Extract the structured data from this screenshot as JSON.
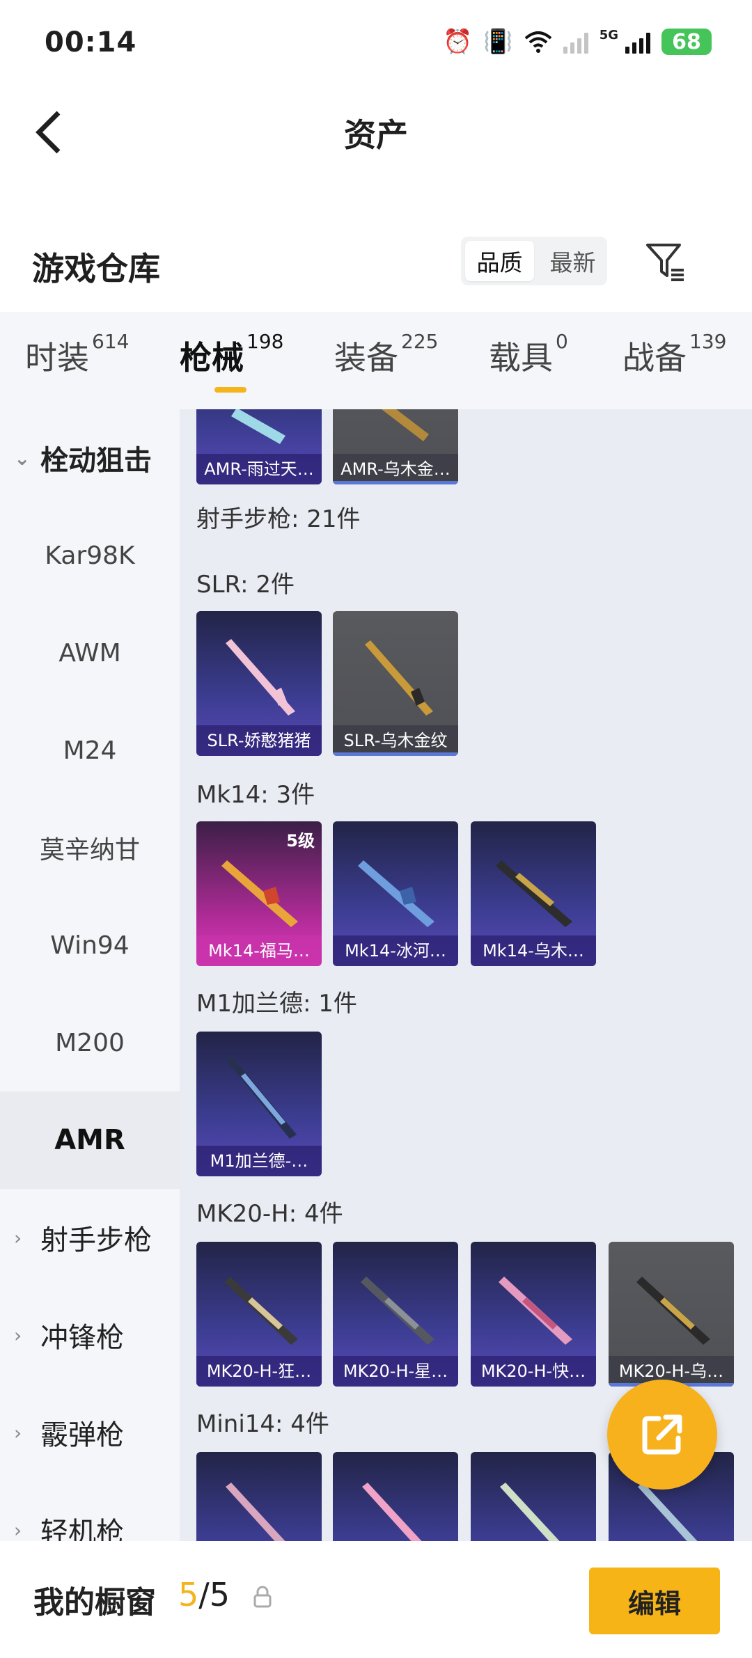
{
  "status_bar": {
    "time": "00:14",
    "network": "5G",
    "battery": "68"
  },
  "header": {
    "title": "资产",
    "back_icon": "back-arrow-icon"
  },
  "warehouse": {
    "title": "游戏仓库",
    "sort_options": [
      "品质",
      "最新"
    ],
    "active_sort": "品质",
    "filter_icon": "filter-icon"
  },
  "tabs": [
    {
      "label": "时装",
      "count": "614"
    },
    {
      "label": "枪械",
      "count": "198"
    },
    {
      "label": "装备",
      "count": "225"
    },
    {
      "label": "载具",
      "count": "0"
    },
    {
      "label": "战备",
      "count": "139"
    }
  ],
  "active_tab": "枪械",
  "sidebar": {
    "groups": [
      {
        "label": "栓动狙击",
        "expanded": true,
        "items": [
          "Kar98K",
          "AWM",
          "M24",
          "莫辛纳甘",
          "Win94",
          "M200",
          "AMR"
        ]
      },
      {
        "label": "射手步枪",
        "expanded": false
      },
      {
        "label": "冲锋枪",
        "expanded": false
      },
      {
        "label": "霰弹枪",
        "expanded": false
      },
      {
        "label": "轻机枪",
        "expanded": false
      }
    ],
    "selected": "AMR"
  },
  "content": {
    "top_partial": [
      "AMR-雨过天…",
      "AMR-乌木金…"
    ],
    "category_header": "射手步枪: 21件",
    "sections": [
      {
        "title": "SLR: 2件",
        "items": [
          "SLR-娇憨猪猪",
          "SLR-乌木金纹"
        ]
      },
      {
        "title": "Mk14: 3件",
        "items": [
          "Mk14-福马…",
          "Mk14-冰河…",
          "Mk14-乌木…"
        ],
        "level_badge": "5级"
      },
      {
        "title": "M1加兰德: 1件",
        "items": [
          "M1加兰德-…"
        ]
      },
      {
        "title": "MK20-H: 4件",
        "items": [
          "MK20-H-狂…",
          "MK20-H-星…",
          "MK20-H-快…",
          "MK20-H-乌…"
        ]
      },
      {
        "title": "Mini14: 4件",
        "items": [
          "",
          "",
          "",
          ""
        ]
      }
    ]
  },
  "fab_icon": "share-external-icon",
  "bottom_bar": {
    "title": "我的橱窗",
    "used": "5",
    "separator": "/",
    "total": "5",
    "lock_icon": "lock-icon",
    "edit_label": "编辑"
  },
  "colors": {
    "accent": "#f5b41c",
    "purple_card": "#3c3d92",
    "grey_card": "#595a5e",
    "pink_card": "#b52c9b"
  }
}
